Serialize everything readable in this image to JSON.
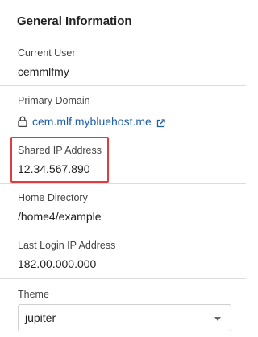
{
  "panel": {
    "title": "General Information"
  },
  "current_user": {
    "label": "Current User",
    "value": "cemmlfmy"
  },
  "primary_domain": {
    "label": "Primary Domain",
    "value": "cem.mlf.mybluehost.me",
    "icons": [
      "lock-icon",
      "external-link-icon"
    ],
    "link_color": "#1f5fa8"
  },
  "shared_ip": {
    "label": "Shared IP Address",
    "value": "12.34.567.890",
    "highlight_color": "#e03c3c"
  },
  "home_directory": {
    "label": "Home Directory",
    "value": "/home4/example"
  },
  "last_login_ip": {
    "label": "Last Login IP Address",
    "value": "182.00.000.000"
  },
  "theme": {
    "label": "Theme",
    "selected": "jupiter"
  }
}
